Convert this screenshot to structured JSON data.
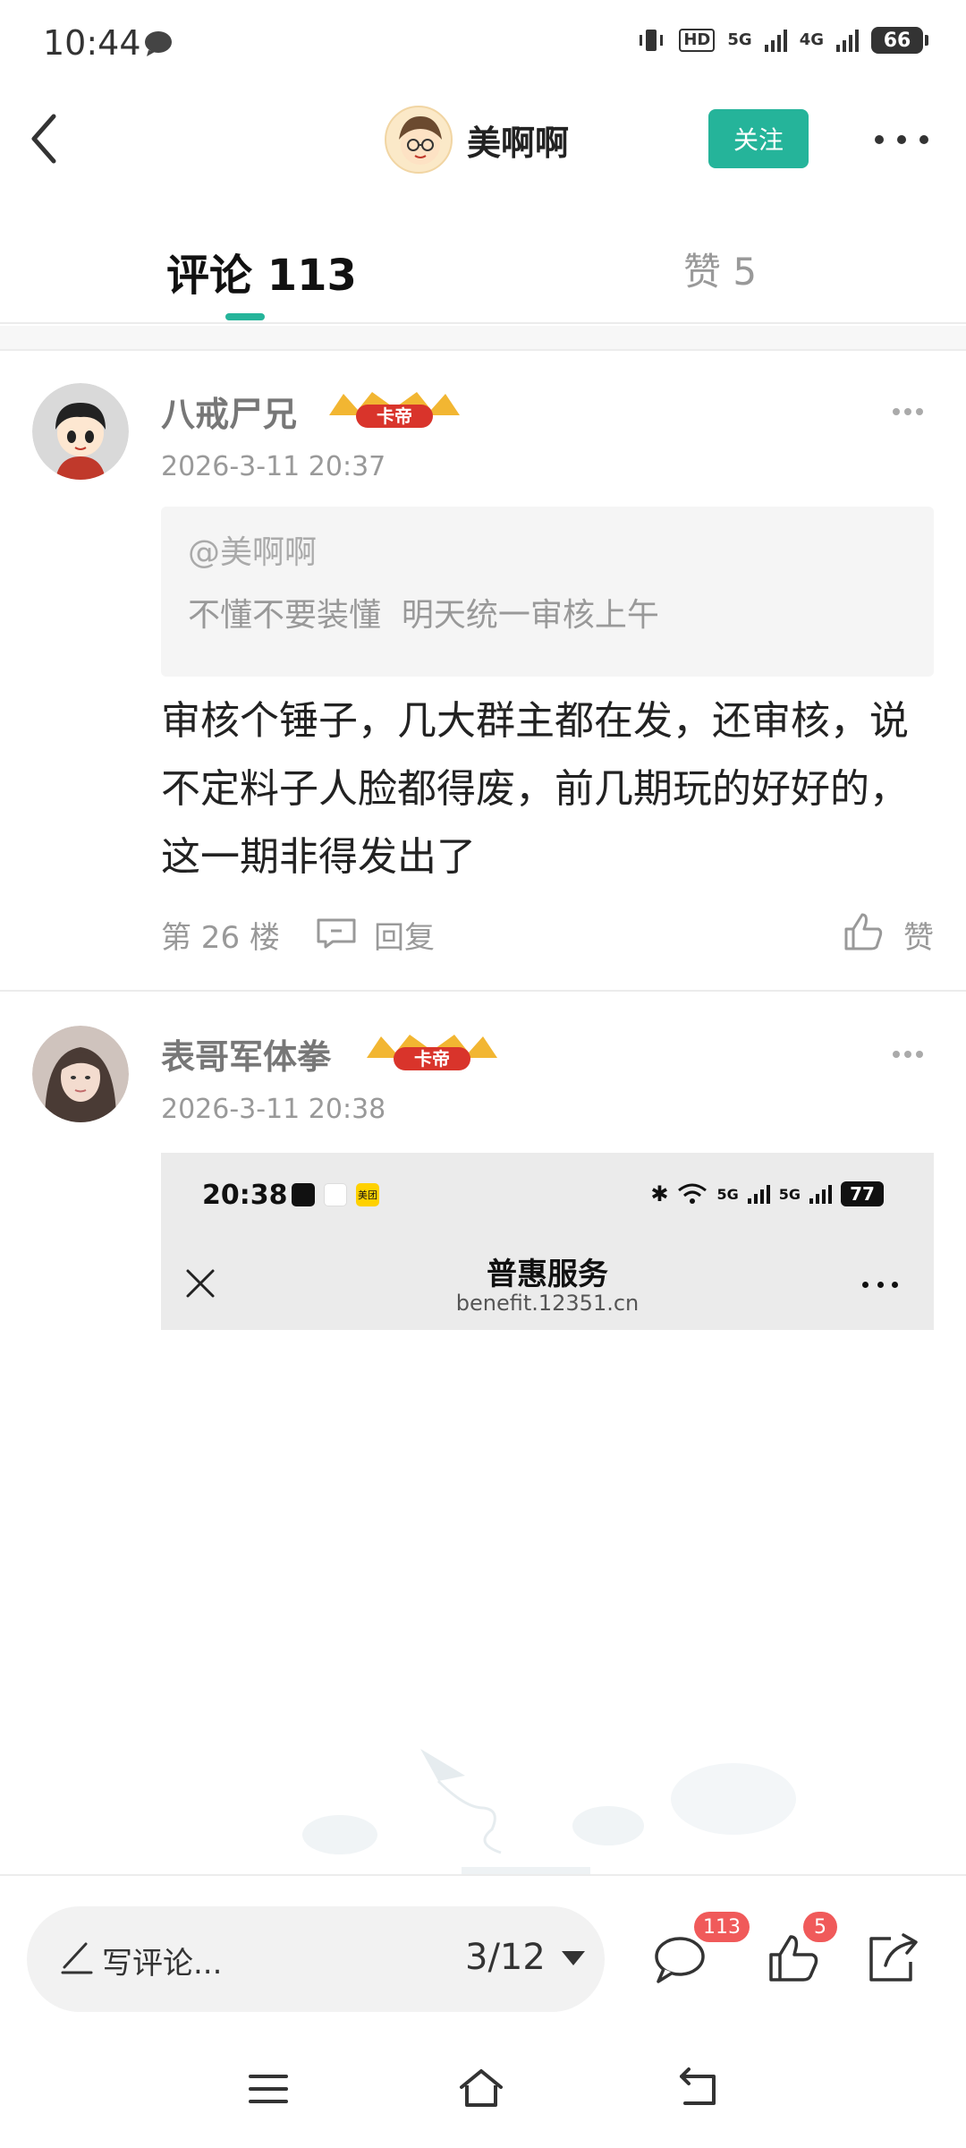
{
  "status_bar": {
    "time": "10:44",
    "network_tag_1": "HD",
    "network_tag_2": "5G",
    "network_tag_3": "4G",
    "battery": "66"
  },
  "header": {
    "user_name": "美啊啊",
    "follow_label": "关注"
  },
  "tabs": {
    "comments_label": "评论 113",
    "likes_label": "赞 5"
  },
  "comments": [
    {
      "author": "八戒尸兄",
      "badge": "卡帝",
      "time": "2026-3-11 20:37",
      "quote_author": "@美啊啊",
      "quote_text": "不懂不要装懂  明天统一审核上午",
      "text": "审核个锤子，几大群主都在发，还审核，说不定料子人脸都得废，前几期玩的好好的，这一期非得发出了",
      "floor": "第 26 楼",
      "reply_label": "回复",
      "like_label": "赞"
    },
    {
      "author": "表哥军体拳",
      "badge": "卡帝",
      "time": "2026-3-11 20:38",
      "embed": {
        "time": "20:38",
        "app_label": "美团",
        "net_1": "5G",
        "net_2": "5G",
        "battery": "77",
        "title": "普惠服务",
        "url": "benefit.12351.cn"
      }
    }
  ],
  "bottom_bar": {
    "compose_placeholder": "写评论...",
    "page_indicator": "3/12",
    "comment_count": "113",
    "like_count": "5"
  },
  "colors": {
    "accent": "#25b49a",
    "badge_red": "#f05a5a"
  }
}
